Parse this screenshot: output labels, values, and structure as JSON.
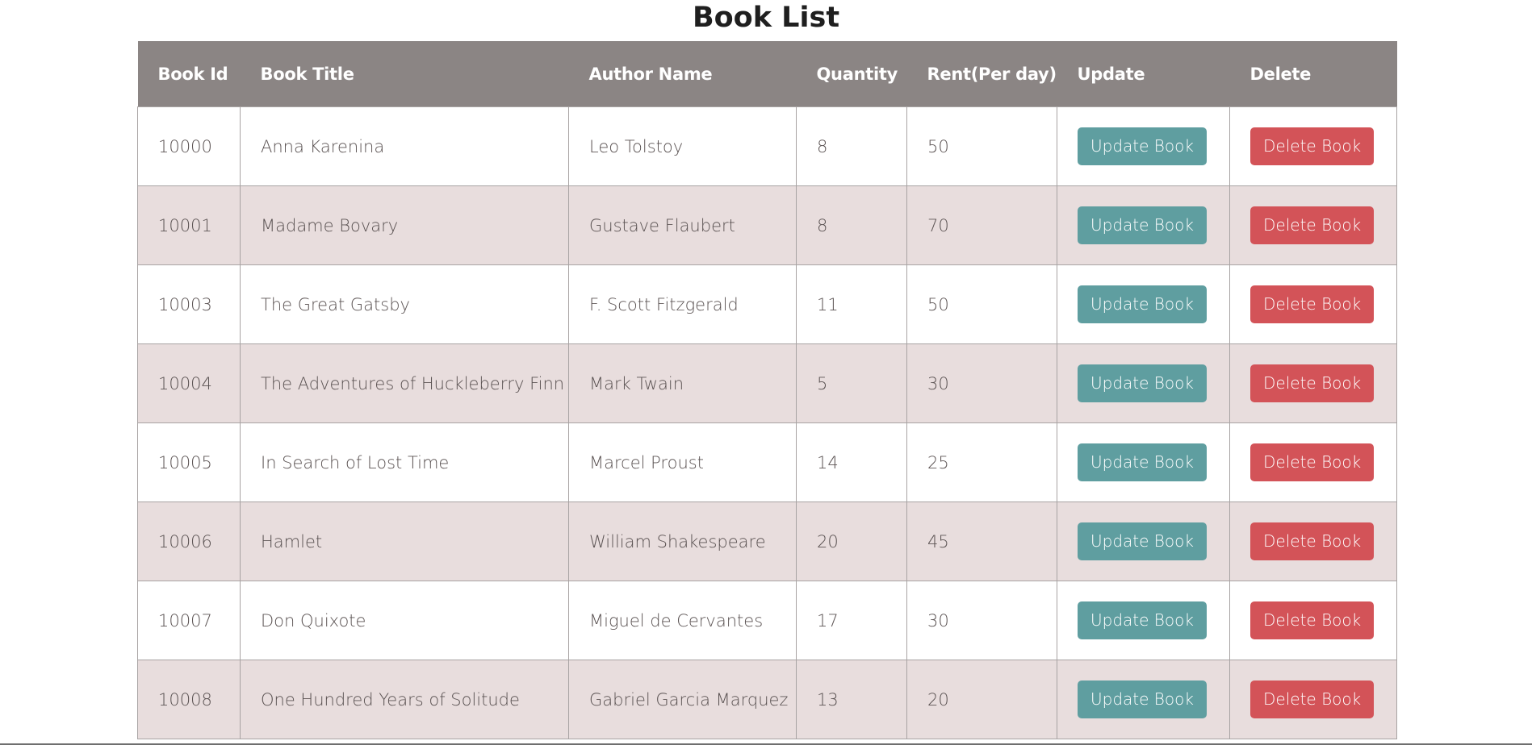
{
  "page": {
    "title": "Book List"
  },
  "table": {
    "headers": {
      "book_id": "Book Id",
      "book_title": "Book Title",
      "author_name": "Author Name",
      "quantity": "Quantity",
      "rent": "Rent(Per day)",
      "update": "Update",
      "delete": "Delete"
    },
    "update_label": "Update Book",
    "delete_label": "Delete Book",
    "rows": [
      {
        "id": "10000",
        "title": "Anna Karenina",
        "author": "Leo Tolstoy",
        "quantity": "8",
        "rent": "50"
      },
      {
        "id": "10001",
        "title": "Madame Bovary",
        "author": "Gustave Flaubert",
        "quantity": "8",
        "rent": "70"
      },
      {
        "id": "10003",
        "title": "The Great Gatsby",
        "author": "F. Scott Fitzgerald",
        "quantity": "11",
        "rent": "50"
      },
      {
        "id": "10004",
        "title": "The Adventures of Huckleberry Finn",
        "author": "Mark Twain",
        "quantity": "5",
        "rent": "30"
      },
      {
        "id": "10005",
        "title": "In Search of Lost Time",
        "author": "Marcel Proust",
        "quantity": "14",
        "rent": "25"
      },
      {
        "id": "10006",
        "title": "Hamlet",
        "author": "William Shakespeare",
        "quantity": "20",
        "rent": "45"
      },
      {
        "id": "10007",
        "title": "Don Quixote",
        "author": "Miguel de Cervantes",
        "quantity": "17",
        "rent": "30"
      },
      {
        "id": "10008",
        "title": "One Hundred Years of Solitude",
        "author": "Gabriel Garcia Marquez",
        "quantity": "13",
        "rent": "20"
      }
    ]
  },
  "colors": {
    "header_bg": "#8b8584",
    "even_row_bg": "#e8dddd",
    "update_button": "#5f9ea0",
    "delete_button": "#d35358"
  }
}
